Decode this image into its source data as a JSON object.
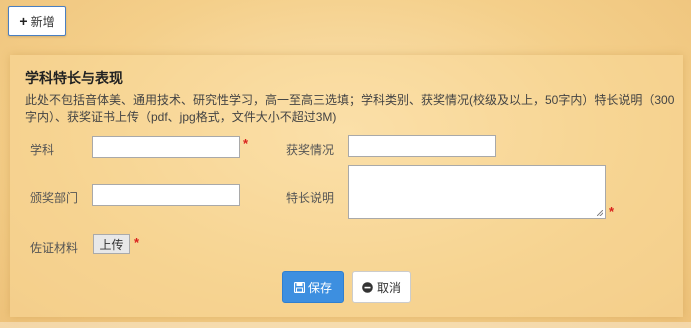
{
  "toolbar": {
    "add_label": "新增"
  },
  "panel": {
    "title": "学科特长与表现",
    "description": "此处不包括音体美、通用技术、研究性学习，高一至高三选填；学科类别、获奖情况(校级及以上，50字内）特长说明（300字内）、获奖证书上传（pdf、jpg格式，文件大小不超过3M)"
  },
  "form": {
    "subject_label": "学科",
    "subject_value": "",
    "award_label": "获奖情况",
    "award_value": "",
    "issuer_label": "颁奖部门",
    "issuer_value": "",
    "specialty_label": "特长说明",
    "specialty_value": "",
    "evidence_label": "佐证材料",
    "upload_label": "上传",
    "required_mark": "*"
  },
  "actions": {
    "save_label": "保存",
    "cancel_label": "取消"
  },
  "colors": {
    "primary": "#3d8fe0",
    "required": "#d9201c",
    "background": "#f4cf8a"
  },
  "icons": {
    "add": "plus-icon",
    "save": "save-icon",
    "cancel": "minus-circle-icon",
    "resize": "resize-grip-icon"
  }
}
